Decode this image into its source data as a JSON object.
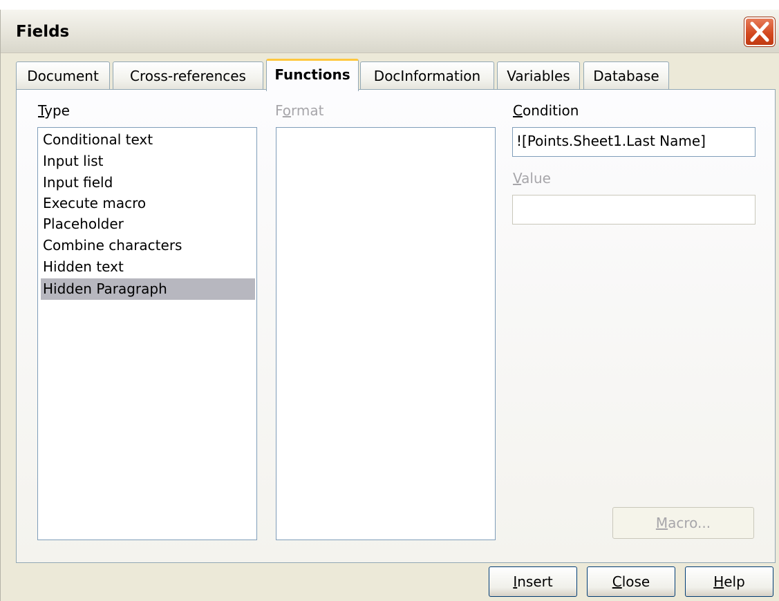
{
  "dialog": {
    "title": "Fields",
    "close_icon": "close-x-icon"
  },
  "tabs": [
    {
      "label": "Document",
      "active": false
    },
    {
      "label": "Cross-references",
      "active": false
    },
    {
      "label": "Functions",
      "active": true
    },
    {
      "label": "DocInformation",
      "active": false
    },
    {
      "label": "Variables",
      "active": false
    },
    {
      "label": "Database",
      "active": false
    }
  ],
  "type_panel": {
    "label_first": "T",
    "label_rest": "ype",
    "items": [
      "Conditional text",
      "Input list",
      "Input field",
      "Execute macro",
      "Placeholder",
      "Combine characters",
      "Hidden text",
      "Hidden Paragraph"
    ],
    "selected_item": "Hidden Paragraph"
  },
  "format_panel": {
    "label_first": "F",
    "label_u": "o",
    "label_rest": "rmat",
    "items": []
  },
  "condition": {
    "label_first": "C",
    "label_rest": "ondition",
    "value": "![Points.Sheet1.Last Name]"
  },
  "value_field": {
    "label_first": "V",
    "label_rest": "alue",
    "value": ""
  },
  "buttons": {
    "macro_first": "M",
    "macro_rest": "acro...",
    "insert_first": "I",
    "insert_rest": "nsert",
    "close_first": "C",
    "close_rest": "lose",
    "help_first": "H",
    "help_rest": "elp"
  }
}
